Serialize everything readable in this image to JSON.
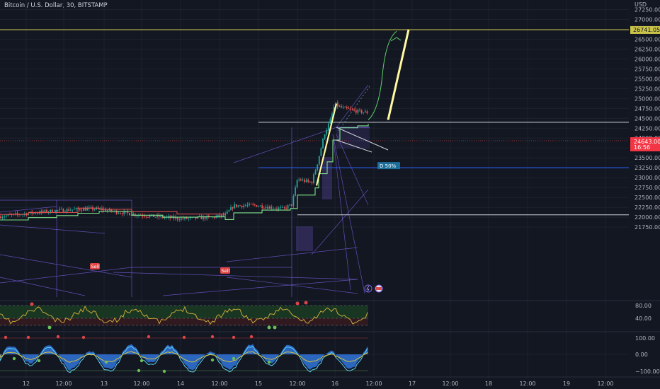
{
  "header": {
    "title": "Bitcoin / U.S. Dollar, 30, BITSTAMP"
  },
  "price_axis": {
    "currency": "USD",
    "ticks": [
      "27250.00",
      "27000.00",
      "26750.00",
      "26500.00",
      "26250.00",
      "26000.00",
      "25750.00",
      "25500.00",
      "25250.00",
      "25000.00",
      "24750.00",
      "24500.00",
      "24250.00",
      "24000.00",
      "23750.00",
      "23500.00",
      "23250.00",
      "23000.00",
      "22750.00",
      "22500.00",
      "22250.00",
      "22000.00",
      "21750.00"
    ],
    "target_label": "26741.05",
    "current_price": "24643.00",
    "countdown": "16:56"
  },
  "osc1_axis": {
    "ticks": [
      "80.00",
      "40.00"
    ]
  },
  "osc2_axis": {
    "ticks": [
      "100.00",
      "0.00",
      "−100.00"
    ]
  },
  "time_axis": {
    "ticks": [
      "12",
      "12:00",
      "13",
      "12:00",
      "14",
      "12:00",
      "15",
      "12:00",
      "16",
      "12:00",
      "17",
      "12:00",
      "18",
      "12:00",
      "19",
      "12:00"
    ]
  },
  "annotations": {
    "sell1": "Sell",
    "sell2": "Sell",
    "level_label": "D 50%"
  },
  "chart_data": {
    "type": "line",
    "title": "Bitcoin / U.S. Dollar, 30, BITSTAMP",
    "ylim": [
      21620,
      27400
    ],
    "x": [
      "12",
      "12:00",
      "13",
      "12:00",
      "14",
      "12:00",
      "15",
      "12:00",
      "16",
      "12:00"
    ],
    "series": [
      {
        "name": "",
        "values": [
          22020,
          22160,
          22210,
          22030,
          21960,
          22050,
          22290,
          22340,
          24870,
          24600
        ]
      }
    ],
    "levels": [
      26741.05,
      24400,
      23250,
      22060
    ],
    "projection": [
      [
        24460,
        26741.05
      ]
    ]
  },
  "colors": {
    "background": "#131722",
    "up": "#26a69a",
    "down": "#ef5350",
    "target_line": "#c9c34a",
    "purple": "#7b5fe6",
    "blue_level": "#2962ff",
    "projection": "#fff9a0"
  }
}
